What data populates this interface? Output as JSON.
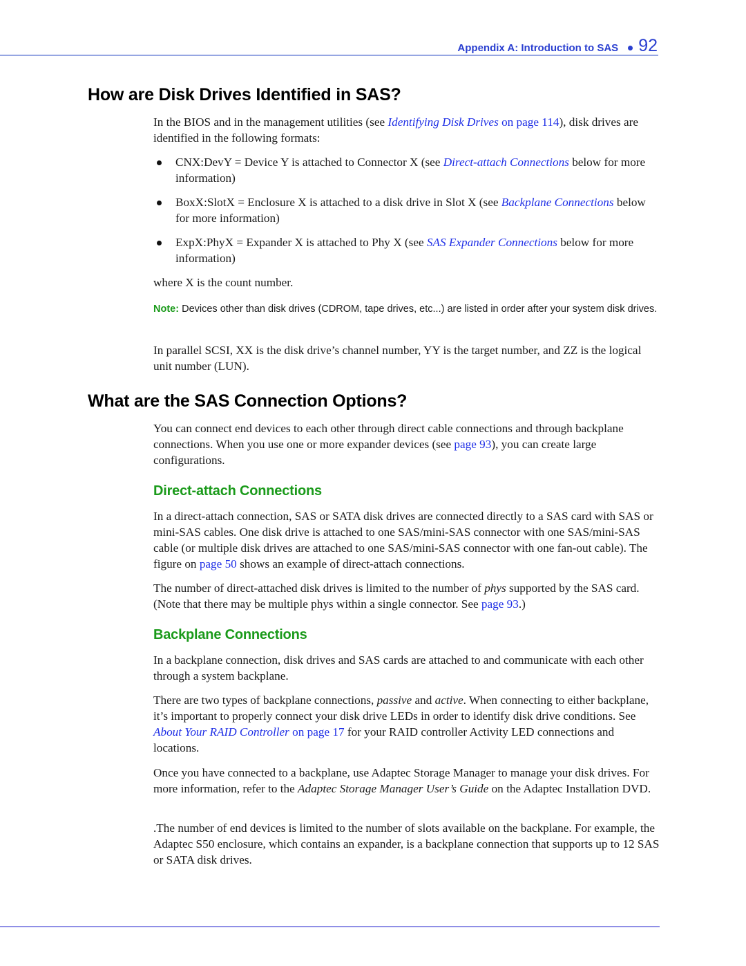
{
  "header": {
    "title": "Appendix A: Introduction to SAS",
    "page_number": "92"
  },
  "section1": {
    "heading": "How are Disk Drives Identified in SAS?",
    "intro": {
      "before": "In the BIOS and in the management utilities (see ",
      "link_italic": "Identifying Disk Drives",
      "link_plain": " on page 114",
      "after": "), disk drives are identified in the following formats:"
    },
    "bullets": [
      {
        "before": "CNX:DevY = Device Y is attached to Connector X (see ",
        "link": "Direct-attach Connections",
        "after": " below for more information)"
      },
      {
        "before": "BoxX:SlotX = Enclosure X is attached to a disk drive in Slot X (see ",
        "link": "Backplane Connections",
        "after": " below for more information)"
      },
      {
        "before": "ExpX:PhyX = Expander X is attached to Phy X (see ",
        "link": "SAS Expander Connections",
        "after": " below for more information)"
      }
    ],
    "where": "where X is the count number.",
    "note": {
      "label": "Note:",
      "text": " Devices other than disk drives (CDROM, tape drives, etc...) are listed in order after your system disk drives."
    },
    "parallel": "In parallel SCSI, XX is the disk drive’s channel number, YY is the target number, and ZZ is the logical unit number (LUN)."
  },
  "section2": {
    "heading": "What are the SAS Connection Options?",
    "intro": {
      "before": "You can connect end devices to each other through direct cable connections and through backplane connections. When you use one or more expander devices (see ",
      "link": "page 93",
      "after": "), you can create large configurations."
    },
    "direct": {
      "heading": "Direct-attach Connections",
      "p1": {
        "before": "In a direct-attach connection, SAS or SATA disk drives are connected directly to a SAS card with SAS or mini-SAS cables. One disk drive is attached to one SAS/mini-SAS connector with one SAS/mini-SAS cable (or multiple disk drives are attached to one SAS/mini-SAS connector with one fan-out cable). The figure on ",
        "link": "page 50",
        "after": " shows an example of direct-attach connections."
      },
      "p2": {
        "before": "The number of direct-attached disk drives is limited to the number of ",
        "italic": "phys",
        "middle": " supported by the SAS card. (Note that there may be multiple phys within a single connector. See ",
        "link": "page 93",
        "after": ".)"
      }
    },
    "backplane": {
      "heading": "Backplane Connections",
      "p1": "In a backplane connection, disk drives and SAS cards are attached to and communicate with each other through a system backplane.",
      "p2": {
        "before": "There are two types of backplane connections, ",
        "italic1": "passive",
        "and": " and ",
        "italic2": "active",
        "middle": ". When connecting to either backplane, it’s important to properly connect your disk drive LEDs in order to identify disk drive conditions. See ",
        "link_italic": "About Your RAID Controller",
        "link_plain": " on page 17",
        "after": " for your RAID controller Activity LED connections and locations."
      },
      "p3": {
        "before": "Once you have connected to a backplane, use Adaptec Storage Manager to manage your disk drives. For more information, refer to the ",
        "italic": "Adaptec Storage Manager User’s Guide",
        "after": " on the Adaptec Installation DVD."
      },
      "p4": ".The number of end devices is limited to the number of slots available on the backplane. For example, the Adaptec S50 enclosure, which contains an expander, is a backplane connection that supports up to 12 SAS or SATA disk drives."
    }
  }
}
